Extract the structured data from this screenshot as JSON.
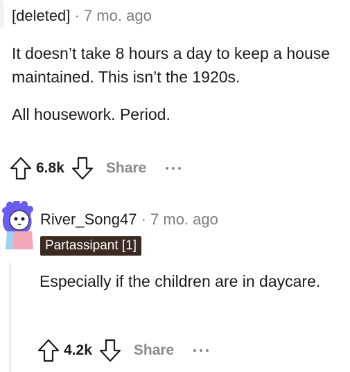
{
  "comment1": {
    "author": "[deleted]",
    "separator": "·",
    "timestamp": "7 mo. ago",
    "paragraphs": [
      "It doesn’t take 8 hours a day to keep a house maintained. This isn’t the 1920s.",
      "All housework. Period."
    ],
    "score": "6.8k",
    "share_label": "Share"
  },
  "comment2": {
    "author": "River_Song47",
    "separator": "·",
    "timestamp": "7 mo. ago",
    "flair": "Partassipant [1]",
    "body": "Especially if the children are in daycare.",
    "score": "4.2k",
    "share_label": "Share"
  },
  "icons": {
    "upvote": "arrow-up-outline-icon",
    "downvote": "arrow-down-outline-icon",
    "more": "ellipsis-horizontal-icon"
  },
  "colors": {
    "text": "#1c1c1c",
    "muted": "#7c7c7c",
    "action_gray": "#878a8c",
    "flair_bg": "#3b2a22",
    "flair_text": "#ffffff"
  }
}
